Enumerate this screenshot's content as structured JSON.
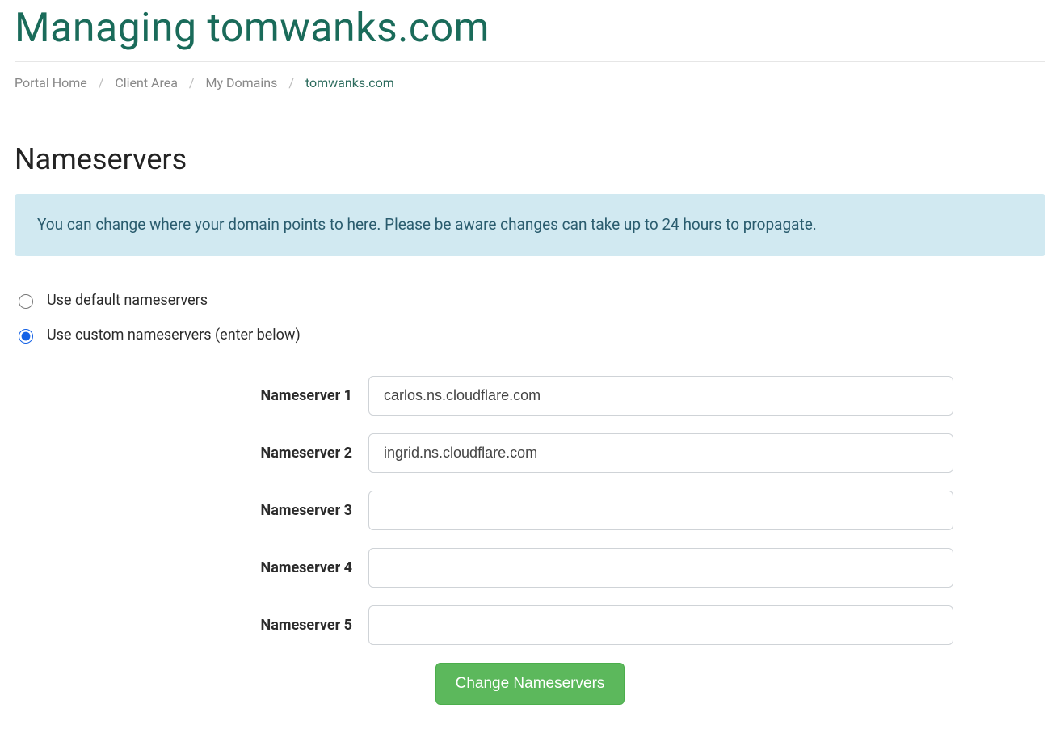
{
  "header": {
    "title": "Managing tomwanks.com"
  },
  "breadcrumb": {
    "items": [
      {
        "label": "Portal Home"
      },
      {
        "label": "Client Area"
      },
      {
        "label": "My Domains"
      }
    ],
    "current": "tomwanks.com",
    "separator": "/"
  },
  "section": {
    "title": "Nameservers"
  },
  "alert": {
    "text": "You can change where your domain points to here. Please be aware changes can take up to 24 hours to propagate."
  },
  "options": {
    "default": {
      "label": "Use default nameservers",
      "checked": false
    },
    "custom": {
      "label": "Use custom nameservers (enter below)",
      "checked": true
    }
  },
  "form": {
    "fields": [
      {
        "label": "Nameserver 1",
        "value": "carlos.ns.cloudflare.com"
      },
      {
        "label": "Nameserver 2",
        "value": "ingrid.ns.cloudflare.com"
      },
      {
        "label": "Nameserver 3",
        "value": ""
      },
      {
        "label": "Nameserver 4",
        "value": ""
      },
      {
        "label": "Nameserver 5",
        "value": ""
      }
    ],
    "submit_label": "Change Nameservers"
  }
}
